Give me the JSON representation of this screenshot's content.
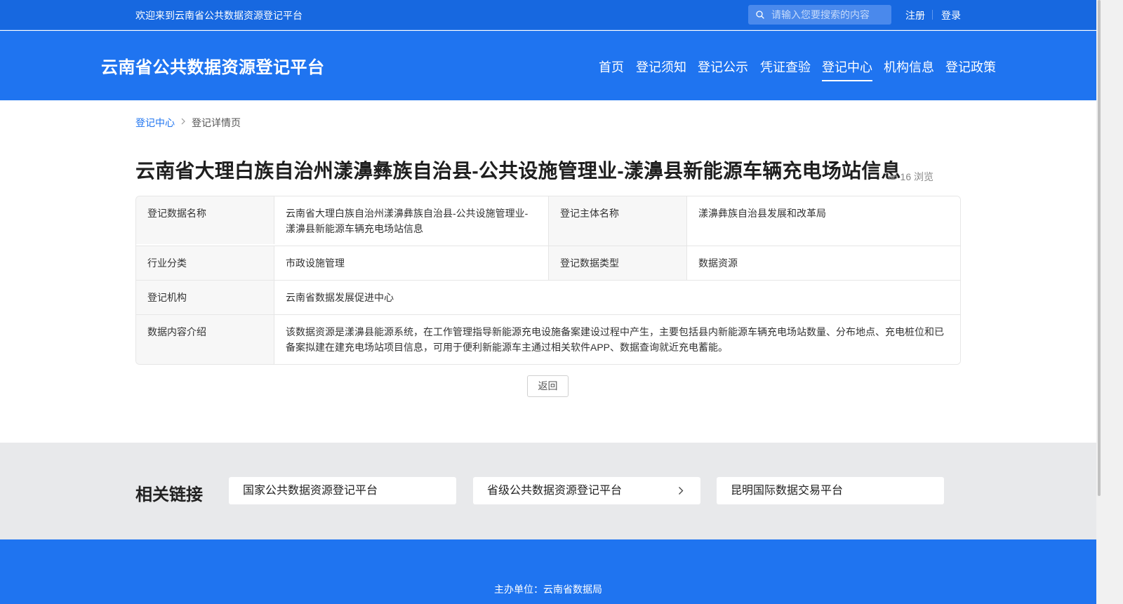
{
  "topbar": {
    "welcome": "欢迎来到云南省公共数据资源登记平台",
    "search_placeholder": "请输入您要搜索的内容",
    "register": "注册",
    "login": "登录"
  },
  "header": {
    "site_title": "云南省公共数据资源登记平台",
    "nav": [
      {
        "label": "首页"
      },
      {
        "label": "登记须知"
      },
      {
        "label": "登记公示"
      },
      {
        "label": "凭证查验"
      },
      {
        "label": "登记中心",
        "active": true
      },
      {
        "label": "机构信息"
      },
      {
        "label": "登记政策"
      }
    ]
  },
  "breadcrumb": [
    "登记中心",
    "登记详情页"
  ],
  "detail": {
    "title": "云南省大理白族自治州漾濞彝族自治县-公共设施管理业-漾濞县新能源车辆充电场站信息",
    "views": "16 浏览",
    "fields": {
      "name_label": "登记数据名称",
      "name_value": "云南省大理白族自治州漾濞彝族自治县-公共设施管理业-漾濞县新能源车辆充电场站信息",
      "subject_label": "登记主体名称",
      "subject_value": "漾濞彝族自治县发展和改革局",
      "industry_label": "行业分类",
      "industry_value": "市政设施管理",
      "type_label": "登记数据类型",
      "type_value": "数据资源",
      "org_label": "登记机构",
      "org_value": "云南省数据发展促进中心",
      "desc_label": "数据内容介绍",
      "desc_value": "该数据资源是漾濞县能源系统，在工作管理指导新能源充电设施备案建设过程中产生，主要包括县内新能源车辆充电场站数量、分布地点、充电桩位和已备案拟建在建充电场站项目信息，可用于便利新能源车主通过相关软件APP、数据查询就近充电蓄能。"
    },
    "back": "返回"
  },
  "related": {
    "title": "相关链接",
    "links": [
      "国家公共数据资源登记平台",
      "省级公共数据资源登记平台",
      "昆明国际数据交易平台"
    ]
  },
  "footer": {
    "host": "主办单位：云南省数据局"
  },
  "colors": {
    "primary": "#1f74f0",
    "topbar": "#1768e0",
    "related_bg": "#e8e9eb"
  }
}
